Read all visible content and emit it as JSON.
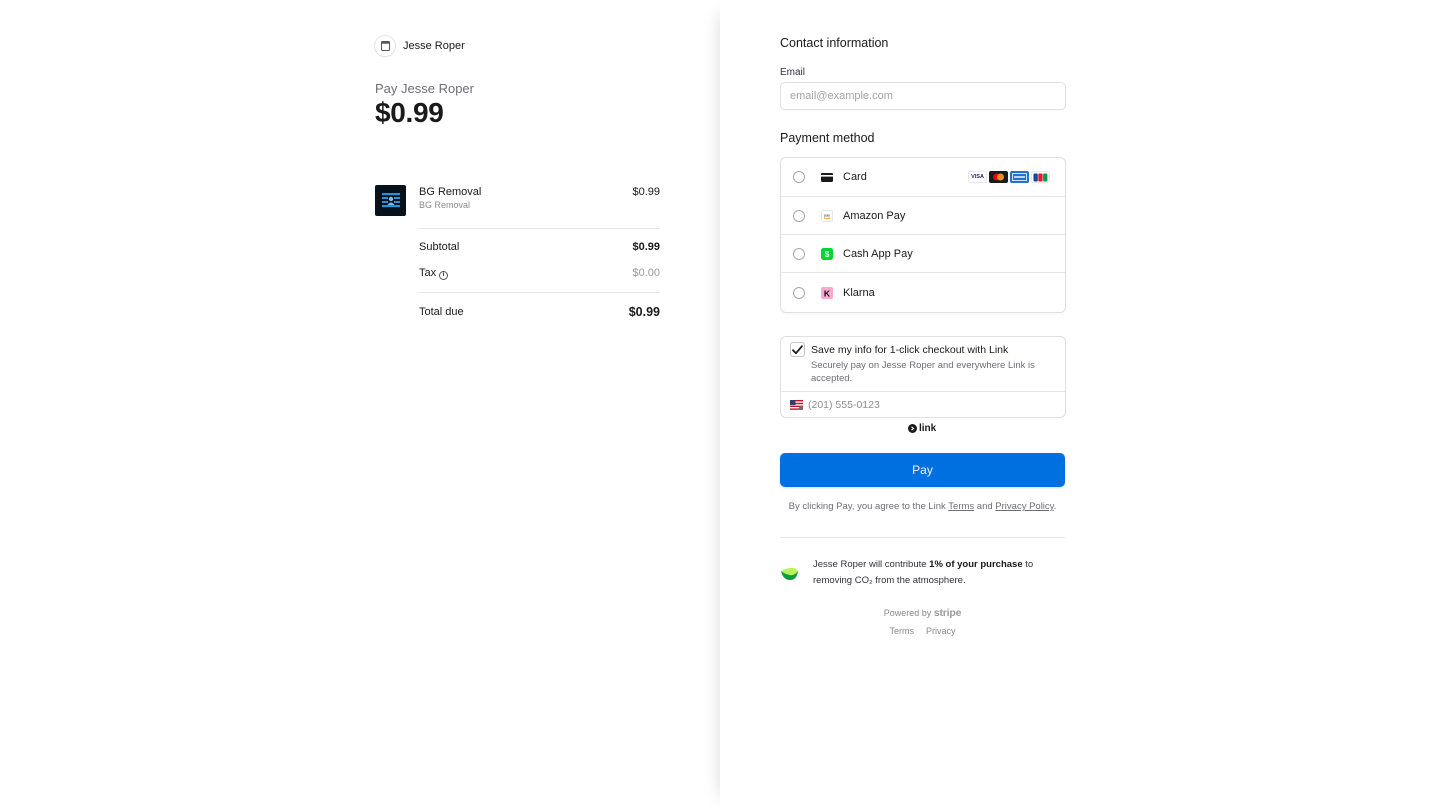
{
  "merchant": {
    "name": "Jesse Roper"
  },
  "summary": {
    "pay_label": "Pay Jesse Roper",
    "amount": "$0.99",
    "item": {
      "name": "BG Removal",
      "description": "BG Removal",
      "price": "$0.99"
    },
    "subtotal_label": "Subtotal",
    "subtotal_value": "$0.99",
    "tax_label": "Tax",
    "tax_value": "$0.00",
    "total_label": "Total due",
    "total_value": "$0.99"
  },
  "contact": {
    "title": "Contact information",
    "email_label": "Email",
    "email_placeholder": "email@example.com"
  },
  "payment": {
    "title": "Payment method",
    "methods": [
      {
        "label": "Card",
        "icon": "card-icon"
      },
      {
        "label": "Amazon Pay",
        "icon": "amazon-pay-icon"
      },
      {
        "label": "Cash App Pay",
        "icon": "cash-app-icon"
      },
      {
        "label": "Klarna",
        "icon": "klarna-icon"
      }
    ],
    "card_brands": [
      "VISA",
      "",
      "",
      "JCB"
    ]
  },
  "link": {
    "checkbox_label": "Save my info for 1-click checkout with Link",
    "checkbox_checked": true,
    "subtext": "Securely pay on Jesse Roper and everywhere Link is accepted.",
    "phone_placeholder": "(201) 555-0123",
    "brand": "link"
  },
  "pay_button": {
    "label": "Pay",
    "color": "#0070e0"
  },
  "terms": {
    "prefix": "By clicking Pay, you agree to the Link",
    "terms_link": "Terms",
    "and": "and",
    "privacy_link": "Privacy Policy",
    "suffix": "."
  },
  "climate": {
    "text_prefix": "Jesse Roper will contribute",
    "text_bold": "1% of your purchase",
    "text_suffix": "to removing CO₂ from the atmosphere."
  },
  "footer": {
    "powered_by": "Powered by",
    "stripe": "stripe",
    "terms": "Terms",
    "privacy": "Privacy"
  }
}
